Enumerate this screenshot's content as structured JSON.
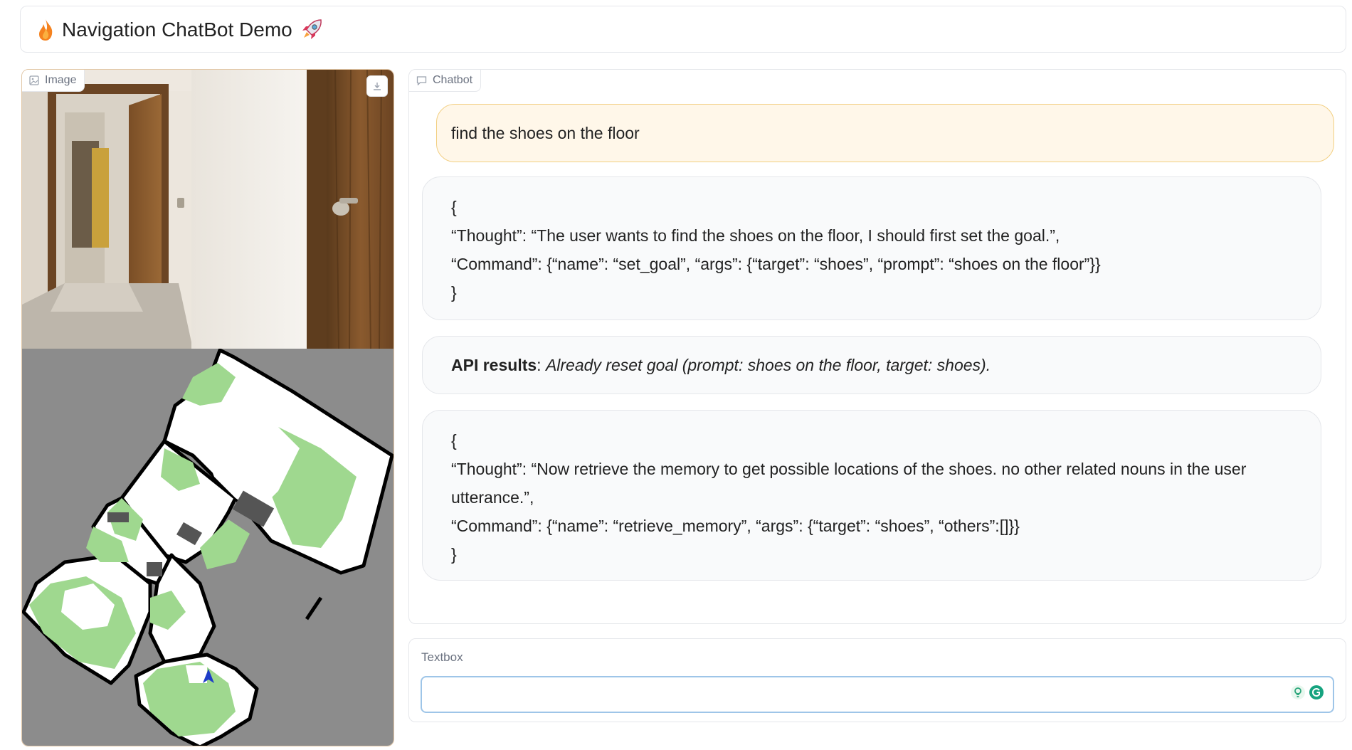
{
  "header": {
    "title": "Navigation ChatBot Demo",
    "left_icon": "fire-icon",
    "right_icon": "rocket-icon"
  },
  "image_panel": {
    "label": "Image",
    "label_icon": "image-icon",
    "download_icon": "download-icon"
  },
  "chatbot": {
    "label": "Chatbot",
    "label_icon": "chat-icon",
    "messages": [
      {
        "role": "user",
        "text": "find the shoes on the floor"
      },
      {
        "role": "bot",
        "lines": [
          "{",
          "“Thought”: “The user wants to find the shoes on the floor, I should first set the goal.”,",
          "“Command”: {“name”: “set_goal”, “args”: {“target”: “shoes”, “prompt”: “shoes on the floor”}}",
          "}"
        ]
      },
      {
        "role": "bot",
        "bold": "API results",
        "sep": ": ",
        "italic": "Already reset goal (prompt: shoes on the floor, target: shoes)."
      },
      {
        "role": "bot",
        "lines": [
          "{",
          "“Thought”: “Now retrieve the memory to get possible locations of the shoes. no other related nouns in the user",
          "utterance.”,",
          "“Command”: {“name”: “retrieve_memory”, “args”: {“target”: “shoes”, “others”:[]}}",
          "}"
        ]
      }
    ]
  },
  "textbox": {
    "label": "Textbox",
    "value": "",
    "placeholder": ""
  },
  "colors": {
    "user_bubble_bg": "#fff7e9",
    "user_bubble_border": "#f2cf82",
    "bot_bubble_bg": "#f9fafb",
    "input_border": "#9ec5e8",
    "map_free": "#ffffff",
    "map_explored": "#9fd88f",
    "map_unknown": "#8c8c8c",
    "map_obstacle": "#000000",
    "agent": "#1e3cc8"
  }
}
